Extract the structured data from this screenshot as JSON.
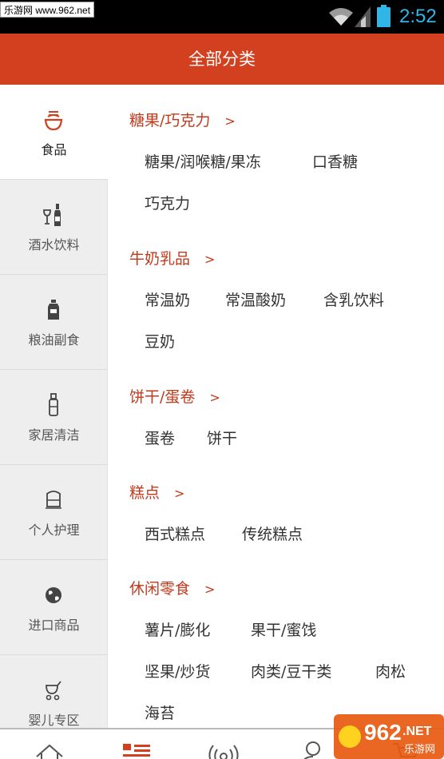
{
  "status": {
    "watermark": "乐游网 www.962.net",
    "time": "2:52"
  },
  "header": {
    "title": "全部分类"
  },
  "sidebar": {
    "items": [
      {
        "label": "食品",
        "icon": "bowl-icon",
        "active": true
      },
      {
        "label": "酒水饮料",
        "icon": "wine-bottle-icon"
      },
      {
        "label": "粮油副食",
        "icon": "oil-bottle-icon"
      },
      {
        "label": "家居清洁",
        "icon": "detergent-bottle-icon"
      },
      {
        "label": "个人护理",
        "icon": "car-seat-icon"
      },
      {
        "label": "进口商品",
        "icon": "globe-icon"
      },
      {
        "label": "婴儿专区",
        "icon": "stroller-icon"
      }
    ]
  },
  "sections": [
    {
      "title": "糖果/巧克力",
      "chevron": ">",
      "items": [
        "糖果/润喉糖/果冻",
        "口香糖",
        "巧克力"
      ]
    },
    {
      "title": "牛奶乳品",
      "chevron": ">",
      "items": [
        "常温奶",
        "常温酸奶",
        "含乳饮料",
        "豆奶"
      ]
    },
    {
      "title": "饼干/蛋卷",
      "chevron": ">",
      "items": [
        "蛋卷",
        "饼干"
      ]
    },
    {
      "title": "糕点",
      "chevron": ">",
      "items": [
        "西式糕点",
        "传统糕点"
      ]
    },
    {
      "title": "休闲零食",
      "chevron": ">",
      "items": [
        "薯片/膨化",
        "果干/蜜饯",
        "坚果/炒货",
        "肉类/豆干类",
        "肉松",
        "海苔"
      ]
    }
  ],
  "bottom_nav": [
    "home-icon",
    "category-list-icon",
    "broadcast-icon",
    "user-icon",
    "cart-icon"
  ],
  "colors": {
    "accent": "#d2401f",
    "section_title": "#c23a1c",
    "clock": "#2fb6e6"
  },
  "logo": {
    "brand": "962",
    "suffix": ".NET",
    "sub": "乐游网"
  }
}
